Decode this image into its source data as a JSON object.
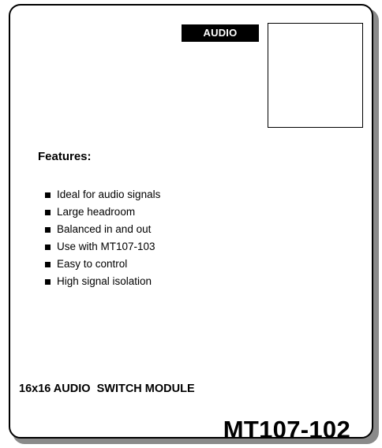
{
  "badge": {
    "label": "AUDIO"
  },
  "features": {
    "heading": "Features:",
    "items": [
      "Ideal for audio signals",
      "Large headroom",
      "Balanced in and out",
      "Use with MT107-103",
      "Easy to control",
      "High signal isolation"
    ]
  },
  "module": {
    "title": "16x16 AUDIO  SWITCH MODULE",
    "model": "MT107-102"
  },
  "colors": {
    "ink": "#000000",
    "paper": "#ffffff",
    "shadow": "#8a8a8a"
  }
}
